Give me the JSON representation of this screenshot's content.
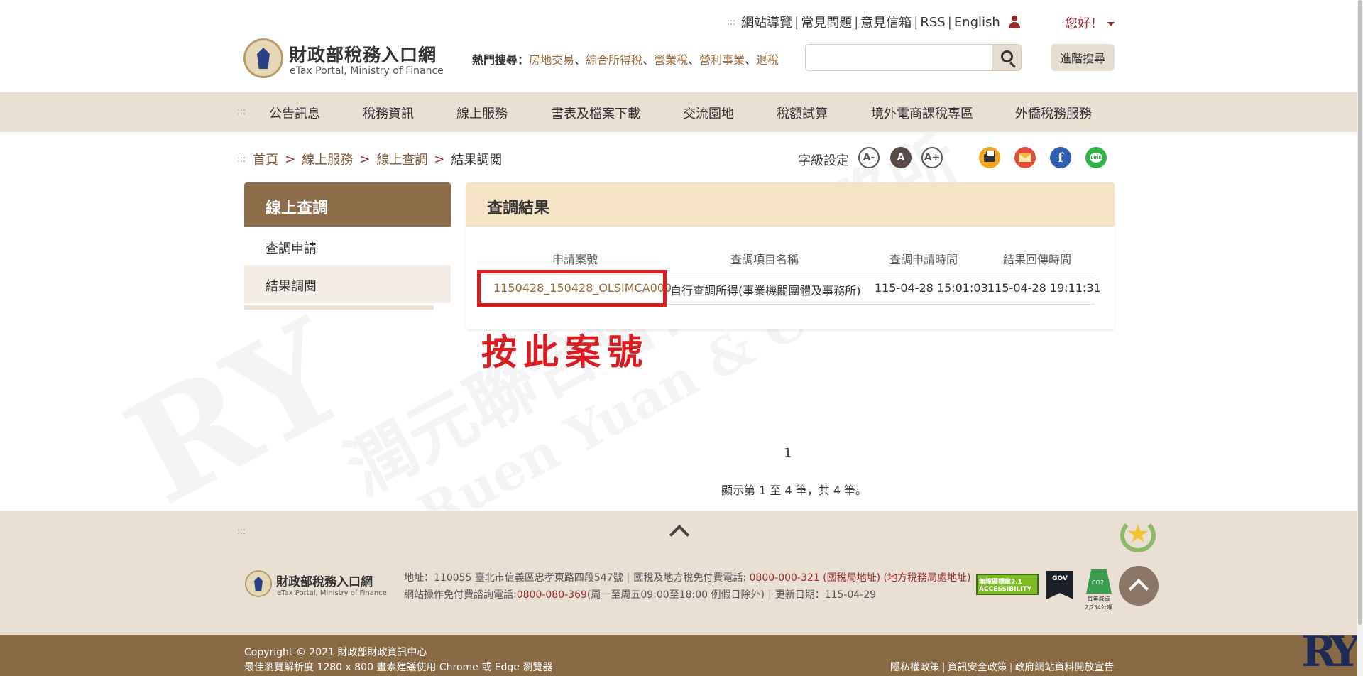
{
  "header": {
    "logo_title": "財政部稅務入口網",
    "logo_subtitle": "eTax Portal, Ministry of Finance",
    "top_links": [
      "網站導覽",
      "常見問題",
      "意見信箱",
      "RSS",
      "English"
    ],
    "greeting": "您好！",
    "hot_search_label": "熱門搜尋：",
    "hot_keywords": [
      "房地交易",
      "綜合所得稅",
      "營業稅",
      "營利事業",
      "退稅"
    ],
    "search_placeholder": "",
    "advanced_search": "進階搜尋"
  },
  "main_nav": [
    "公告訊息",
    "稅務資訊",
    "線上服務",
    "書表及檔案下載",
    "交流園地",
    "稅額試算",
    "境外電商課稅專區",
    "外僑稅務服務"
  ],
  "breadcrumb": {
    "items": [
      "首頁",
      "線上服務",
      "線上查調"
    ],
    "separator": ">",
    "current": "結果調閱"
  },
  "font_settings": {
    "label": "字級設定",
    "buttons": [
      "A-",
      "A",
      "A+"
    ]
  },
  "share_icons": [
    "printer-icon",
    "mail-icon",
    "facebook-icon",
    "line-icon"
  ],
  "share_fb_glyph": "f",
  "share_line_glyph": "LINE",
  "sidebar": {
    "title": "線上查調",
    "items": [
      "查調申請",
      "結果調閱"
    ]
  },
  "results": {
    "title": "查調結果",
    "columns": [
      "申請案號",
      "查調項目名稱",
      "查調申請時間",
      "結果回傳時間"
    ],
    "rows": [
      {
        "case_no": "1150428_150428_OLSIMCA000",
        "item": "自行查調所得(事業機關團體及事務所)",
        "applied": "115-04-28 15:01:03",
        "returned": "115-04-28 19:11:31"
      }
    ],
    "annotation": "按此案號"
  },
  "pagination": {
    "current_page": "1",
    "summary": "顯示第 1 至 4 筆，共 4 筆。"
  },
  "watermark": {
    "cn": "潤元聯合會計師事務所",
    "en": "Ruen Yuan & Co., CPAs.",
    "mark": "RY"
  },
  "footer": {
    "logo_title": "財政部稅務入口網",
    "logo_subtitle": "eTax Portal, Ministry of Finance",
    "address": "地址：110055 臺北市信義區忠孝東路四段547號",
    "tax_phone_label": "國稅及地方稅免付費電話:",
    "tax_phone": "0800-000-321",
    "tax_link1": "(國稅局地址)",
    "tax_link2": "(地方稅務局處地址)",
    "support_label": "網站操作免付費諮詢電話:",
    "support_phone": "0800-080-369",
    "support_hours": "(周一至周五09:00至18:00 例假日除外)",
    "updated": "更新日期：115-04-29",
    "badge_accessibility": "無障礙標章2.1 ACCESSIBILITY",
    "badge_gov": "GOV",
    "badge_co_line1": "每年減碳",
    "badge_co_line2": "2,234公噸",
    "badge_co_text": "CO2"
  },
  "bottom_bar": {
    "copyright": "Copyright © 2021 財政部財政資訊中心",
    "browser_note": "最佳瀏覽解析度 1280 x 800 畫素建議使用 Chrome 或 Edge 瀏覽器",
    "links": [
      "隱私權政策",
      "資訊安全政策",
      "政府網站資料開放宣告"
    ]
  },
  "colors": {
    "brand_brown": "#8c6c48",
    "nav_bg": "#e9dfd3",
    "accent_red": "#9b2c2c",
    "link_brown": "#9c6a3a",
    "highlight_red": "#e11b22"
  }
}
